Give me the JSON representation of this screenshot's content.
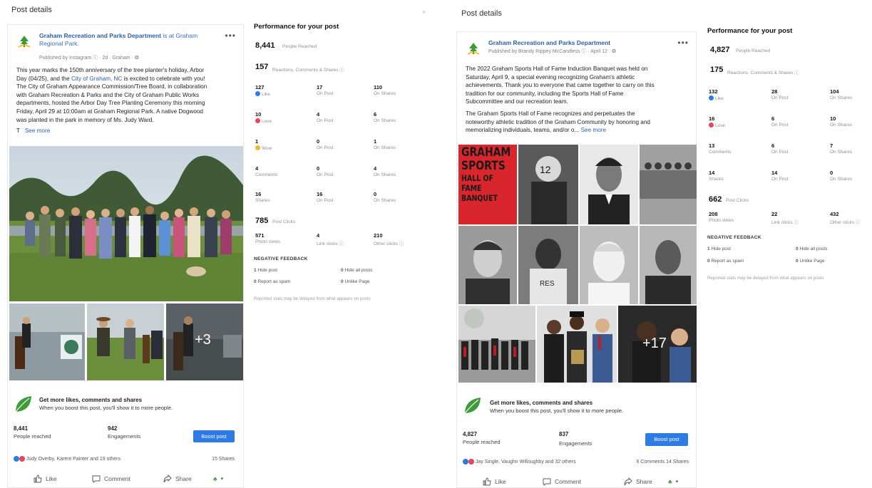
{
  "left": {
    "panel_title": "Post details",
    "close": "×",
    "post": {
      "page_name": "Graham Recreation and Parks Department",
      "page_name_suffix": "is at Graham Regional Park.",
      "meta": "Published by Instagram ⓘ · 2d · Graham · ❂",
      "text_lines": [
        "This year marks the 150th anniversary of the tree planter's holiday, Arbor",
        "Day (04/25), and the",
        "The City of Graham Appearance Commission/Tree Board, in collaboration",
        "with Graham Recreation & Parks and the City of Graham Public Works",
        "departments, hosted the Arbor Day Tree Planting Ceremony this morning",
        "Friday, April 29 at 10:00am at Graham Regional Park. A native Dogwood",
        "was planted in the park in memory of Ms. Judy Ward."
      ],
      "link_text": "City of Graham, NC",
      "line2_suffix": " is excited to celebrate with you!",
      "see_more_prefix": "T",
      "see_more": "See more",
      "more_photos": "+3",
      "boost": {
        "title": "Get more likes, comments and shares",
        "subtitle": "When you boost this post, you'll show it to more people.",
        "reached_value": "8,441",
        "reached_label": "People reached",
        "engagements_value": "942",
        "engagements_label": "Engagements",
        "button": "Boost post"
      },
      "reactions_text": "Judy Overby, Karent Painter and 19 others",
      "shares_text": "15 Shares",
      "actions": {
        "like": "Like",
        "comment": "Comment",
        "share": "Share"
      }
    },
    "performance": {
      "title": "Performance for your post",
      "reached_value": "8,441",
      "reached_label": "People Reached",
      "reactions_value": "157",
      "reactions_label": "Reactions, Comments & Shares ⓘ",
      "rows": [
        {
          "a_num": "127",
          "a_lbl": "Like",
          "b_num": "17",
          "b_lbl": "On Post",
          "c_num": "110",
          "c_lbl": "On Shares"
        },
        {
          "a_num": "10",
          "a_lbl": "Love",
          "b_num": "4",
          "b_lbl": "On Post",
          "c_num": "6",
          "c_lbl": "On Shares"
        },
        {
          "a_num": "1",
          "a_lbl": "Wow",
          "b_num": "0",
          "b_lbl": "On Post",
          "c_num": "1",
          "c_lbl": "On Shares"
        },
        {
          "a_num": "4",
          "a_lbl": "Comments",
          "b_num": "0",
          "b_lbl": "On Post",
          "c_num": "4",
          "c_lbl": "On Shares"
        },
        {
          "a_num": "16",
          "a_lbl": "Shares",
          "b_num": "16",
          "b_lbl": "On Post",
          "c_num": "0",
          "c_lbl": "On Shares"
        }
      ],
      "clicks_value": "785",
      "clicks_label": "Post Clicks",
      "clicks_row": {
        "a_num": "571",
        "a_lbl": "Photo views",
        "b_num": "4",
        "b_lbl": "Link clicks ⓘ",
        "c_num": "210",
        "c_lbl": "Other clicks ⓘ"
      },
      "negative_title": "NEGATIVE FEEDBACK",
      "neg": [
        {
          "num": "1",
          "lbl": "Hide post"
        },
        {
          "num": "0",
          "lbl": "Hide all posts"
        },
        {
          "num": "0",
          "lbl": "Report as spam"
        },
        {
          "num": "0",
          "lbl": "Unlike Page"
        }
      ],
      "note": "Reported stats may be delayed from what appears on posts"
    }
  },
  "right": {
    "panel_title": "Post details",
    "post": {
      "page_name": "Graham Recreation and Parks Department",
      "meta": "Published by Brandy Rippey McCandless ⓘ · April 12 · ❂",
      "text_lines_a": [
        "The 2022 Graham Sports Hall of Fame Induction Banquet was held on",
        "Saturday, April 9, a special evening recognizing Graham's athletic",
        "achievements. Thank you to everyone that came together to carry on this",
        "tradition for our community, including the Sports Hall of Fame",
        "Subcommittee and our recreation team."
      ],
      "text_lines_b": [
        "The Graham Sports Hall of Fame recognizes and perpetuates the",
        "noteworthy athletic tradition of the Graham Community by honoring and",
        "memorializing individuals, teams, and/or o..."
      ],
      "see_more": "See more",
      "banner_lines": [
        "GRAHAM",
        "SPORTS",
        "HALL OF FAME",
        "BANQUET"
      ],
      "more_photos": "+17",
      "boost": {
        "title": "Get more likes, comments and shares",
        "subtitle": "When you boost this post, you'll show it to more people.",
        "reached_value": "4,827",
        "reached_label": "People reached",
        "engagements_value": "837",
        "engagements_label": "Engagements",
        "button": "Boost post"
      },
      "reactions_text": "Jay Single, Vaughn Willoughby and 32 others",
      "comments_shares_text": "6 Comments  14 Shares",
      "actions": {
        "like": "Like",
        "comment": "Comment",
        "share": "Share"
      }
    },
    "performance": {
      "title": "Performance for your post",
      "reached_value": "4,827",
      "reached_label": "People Reached",
      "reactions_value": "175",
      "reactions_label": "Reactions, Comments & Shares ⓘ",
      "rows": [
        {
          "a_num": "132",
          "a_lbl": "Like",
          "b_num": "28",
          "b_lbl": "On Post",
          "c_num": "104",
          "c_lbl": "On Shares"
        },
        {
          "a_num": "16",
          "a_lbl": "Love",
          "b_num": "6",
          "b_lbl": "On Post",
          "c_num": "10",
          "c_lbl": "On Shares"
        },
        {
          "a_num": "13",
          "a_lbl": "Comments",
          "b_num": "6",
          "b_lbl": "On Post",
          "c_num": "7",
          "c_lbl": "On Shares"
        },
        {
          "a_num": "14",
          "a_lbl": "Shares",
          "b_num": "14",
          "b_lbl": "On Post",
          "c_num": "0",
          "c_lbl": "On Shares"
        }
      ],
      "clicks_value": "662",
      "clicks_label": "Post Clicks",
      "clicks_row": {
        "a_num": "208",
        "a_lbl": "Photo views",
        "b_num": "22",
        "b_lbl": "Link clicks ⓘ",
        "c_num": "432",
        "c_lbl": "Other clicks ⓘ"
      },
      "negative_title": "NEGATIVE FEEDBACK",
      "neg": [
        {
          "num": "1",
          "lbl": "Hide post"
        },
        {
          "num": "0",
          "lbl": "Hide all posts"
        },
        {
          "num": "0",
          "lbl": "Report as spam"
        },
        {
          "num": "0",
          "lbl": "Unlike Page"
        }
      ],
      "note": "Reported stats may be delayed from what appears on posts"
    }
  },
  "colors": {
    "link": "#2b5fad",
    "boost_button": "#2d7be5",
    "like": "#2d7be5",
    "love": "#e8455a",
    "wow": "#f2b632",
    "leaf": "#3f9a3a"
  },
  "icons": [
    "tree-logo-icon",
    "more-dots-icon",
    "globe-icon",
    "leaf-icon",
    "like-icon",
    "comment-icon",
    "share-icon",
    "audience-icon",
    "like-reaction-icon",
    "love-reaction-icon",
    "wow-reaction-icon"
  ]
}
